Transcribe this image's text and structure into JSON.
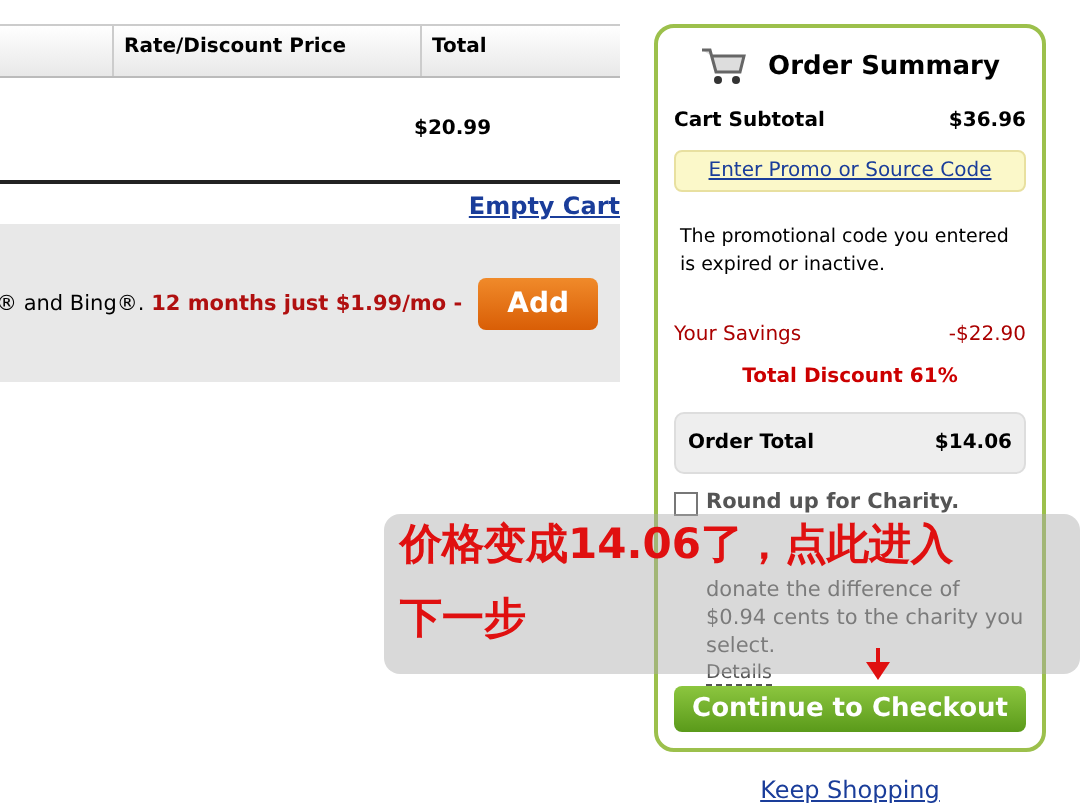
{
  "cart_table": {
    "columns": [
      "Rate/Discount Price",
      "Total"
    ],
    "rows": [
      {
        "total": "$20.99"
      }
    ]
  },
  "empty_cart_link": "Empty Cart",
  "offer": {
    "text": "® and Bing®.",
    "highlight": "12 months just $1.99/mo -",
    "button": "Add"
  },
  "order_summary": {
    "title": "Order Summary",
    "subtotal_label": "Cart Subtotal",
    "subtotal": "$36.96",
    "promo_link": "Enter Promo or Source Code",
    "promo_message": "The promotional code you entered is expired or inactive.",
    "savings_label": "Your Savings",
    "savings": "-$22.90",
    "total_discount": "Total Discount 61%",
    "order_total_label": "Order Total",
    "order_total": "$14.06",
    "charity": {
      "checked": false,
      "title": "Round up for Charity.",
      "description": "donate the difference of $0.94 cents to the charity you select.",
      "details_link": "Details"
    },
    "checkout_button": "Continue to Checkout"
  },
  "keep_shopping_link": "Keep Shopping",
  "annotation": {
    "lines": [
      "价格变成14.06了，点此进入",
      "下一步"
    ]
  }
}
